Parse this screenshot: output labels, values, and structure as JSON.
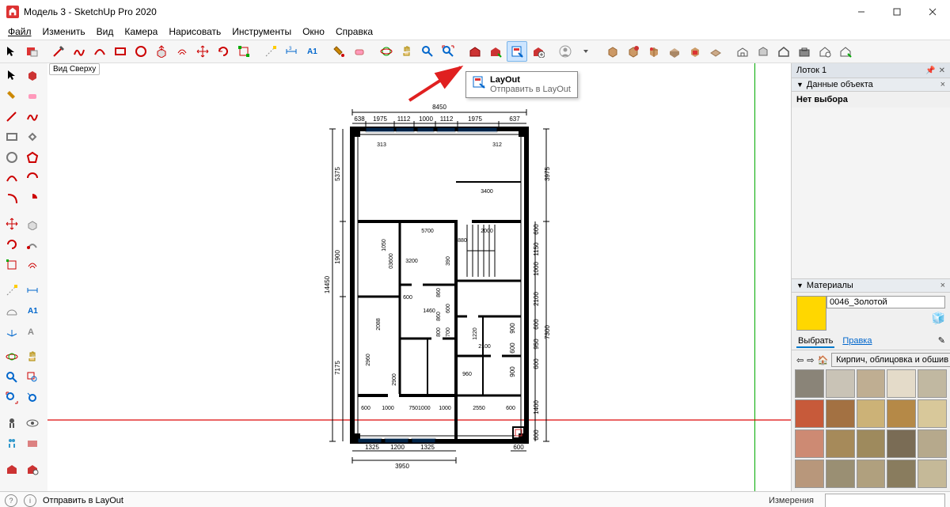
{
  "window": {
    "title": "Модель 3 - SketchUp Pro 2020"
  },
  "menu": {
    "file": "Файл",
    "edit": "Изменить",
    "view": "Вид",
    "camera": "Камера",
    "draw": "Нарисовать",
    "tools": "Инструменты",
    "window": "Окно",
    "help": "Справка"
  },
  "view_tab": "Вид Сверху",
  "tooltip": {
    "title": "LayOut",
    "subtitle": "Отправить в LayOut"
  },
  "tray": {
    "title": "Лоток 1",
    "entity_panel": "Данные объекта",
    "no_selection": "Нет выбора",
    "materials_panel": "Материалы",
    "material_name": "0046_Золотой",
    "tab_select": "Выбрать",
    "tab_edit": "Правка",
    "category": "Кирпич, облицовка и обшив"
  },
  "status": {
    "text": "Отправить в LayOut",
    "measurements": "Измерения"
  },
  "dims": {
    "top_total": "8450",
    "top_segs": [
      "638",
      "1975",
      "1112",
      "1000",
      "1112",
      "1975",
      "637"
    ],
    "left_total": "14450",
    "left_segs": [
      "5375",
      "1900",
      "7175"
    ],
    "bottom_total": "3950",
    "bottom_segs": [
      "1325",
      "1200",
      "1325"
    ],
    "right_outer": [
      "3975",
      "7300"
    ],
    "right_inner": [
      "600",
      "1150",
      "1000",
      "2100",
      "600",
      "950",
      "600",
      "1400",
      "600"
    ],
    "right_mid": [
      "900",
      "600",
      "900"
    ],
    "inside": {
      "a": "313",
      "b": "312",
      "c": "3400",
      "d": "5700",
      "e": "2000",
      "f": "1050",
      "g": "03600",
      "h": "3200",
      "i": "600",
      "j": "1460",
      "k": "1880",
      "l": "2088",
      "m": "2960",
      "n": "2900",
      "o": "7501000",
      "p": "2550",
      "q": "600",
      "r": "960",
      "s": "1220",
      "t": "2100",
      "u": "860",
      "v": "1000",
      "w": "1000",
      "x": "600",
      "y": "860",
      "z": "600",
      "aa": "800",
      "ab": "700",
      "ac": "390"
    }
  },
  "textures": [
    "#8a8478",
    "#c9c3b6",
    "#bfae92",
    "#e4dbc9",
    "#c1b8a1",
    "#c75a3a",
    "#a37142",
    "#ccb277",
    "#b58947",
    "#d8c89a",
    "#cd8a73",
    "#a68a5a",
    "#9e8a5d",
    "#7a6c55",
    "#b6a98c",
    "#b8977b",
    "#9a8f73",
    "#b0a07e",
    "#897c5e",
    "#c5b998"
  ]
}
